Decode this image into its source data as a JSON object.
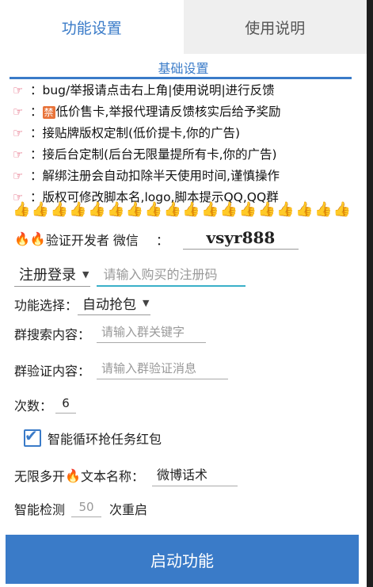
{
  "tabs": [
    {
      "label": "功能设置",
      "active": true
    },
    {
      "label": "使用说明",
      "active": false
    }
  ],
  "section_title": "基础设置",
  "notes": [
    {
      "icon": "pointing-hand-icon",
      "prefix": "：",
      "text": "bug/举报请点击右上角|使用说明|进行反馈"
    },
    {
      "icon": "pointing-hand-icon",
      "prefix": "：",
      "badge": "禁",
      "text": "低价售卡,举报代理请反馈核实后给予奖励"
    },
    {
      "icon": "pointing-hand-icon",
      "prefix": "：",
      "text": "接贴牌版权定制(低价提卡,你的广告)"
    },
    {
      "icon": "pointing-hand-icon",
      "prefix": "：",
      "text": "接后台定制(后台无限量提所有卡,你的广告)"
    },
    {
      "icon": "pointing-hand-icon",
      "prefix": "：",
      "text": "解绑注册会自动扣除半天使用时间,谨慎操作"
    },
    {
      "icon": "pointing-hand-icon",
      "prefix": "：",
      "text": "版权可修改脚本名,logo,脚本提示QQ,QQ群"
    }
  ],
  "thumbs_row": "👍👍👍👍👍👍👍👍👍👍👍👍👍👍👍👍👍👍",
  "verify": {
    "label": "验证开发者 微信",
    "colon": "：",
    "value": "vsyr888"
  },
  "register": {
    "mode": "注册登录",
    "placeholder": "请输入购买的注册码"
  },
  "function_select": {
    "label": "功能选择：",
    "value": "自动抢包"
  },
  "group_search": {
    "label": "群搜索内容：",
    "placeholder": "请输入群关键字"
  },
  "group_verify": {
    "label": "群验证内容：",
    "placeholder": "请输入群验证消息"
  },
  "count": {
    "label": "次数：",
    "value": "6"
  },
  "smart_loop": {
    "label": "智能循环抢任务红包",
    "checked": true
  },
  "multi_open": {
    "label_a": "无限多开",
    "label_b": "文本名称：",
    "value": "微博话术"
  },
  "smart_detect": {
    "label": "智能检测",
    "value": "50",
    "suffix": "次重启"
  },
  "start_button": "启动功能",
  "colors": {
    "accent": "#3a7bc8",
    "hand": "#e0506c",
    "fire": "#f08a1c"
  }
}
